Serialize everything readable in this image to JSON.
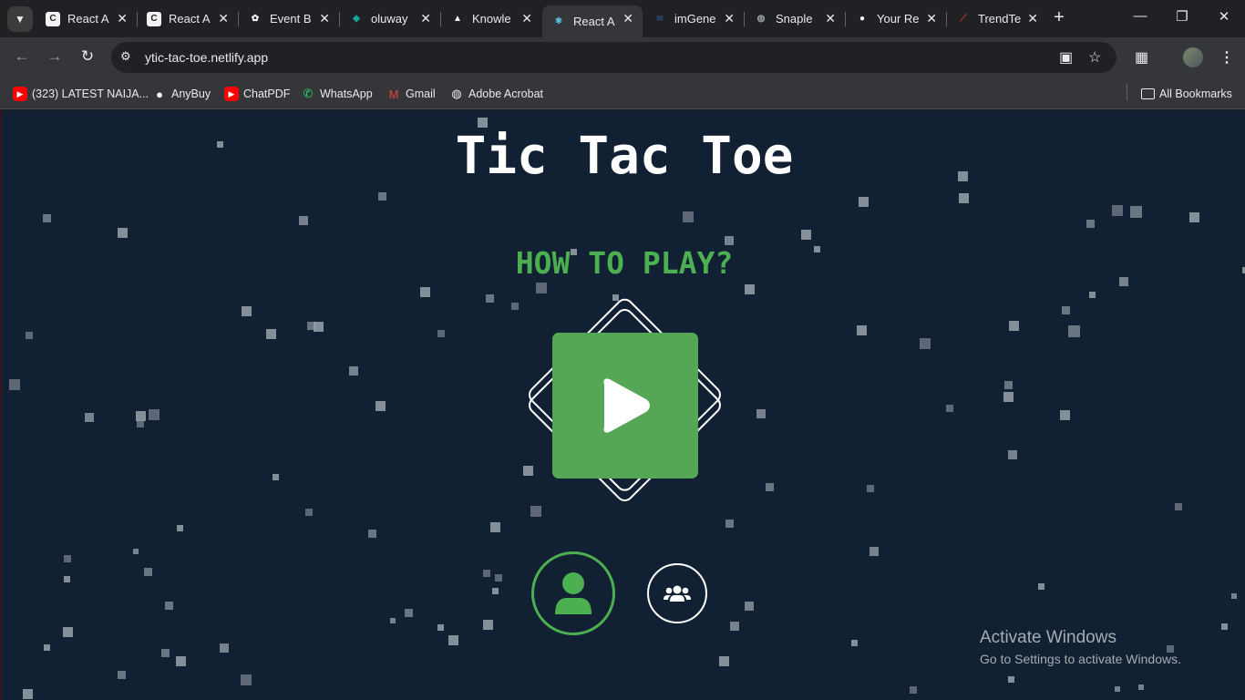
{
  "browser": {
    "tabs": [
      {
        "title": "React A",
        "favicon_icon": "react-a-favicon",
        "color": "#f1f3f4"
      },
      {
        "title": "React A",
        "favicon_icon": "react-a-favicon",
        "color": "#f1f3f4"
      },
      {
        "title": "Event B",
        "favicon_icon": "chatgpt-icon",
        "color": "#ffffff"
      },
      {
        "title": "oluway",
        "favicon_icon": "diamond-icon",
        "color": "#13a89e"
      },
      {
        "title": "Knowle",
        "favicon_icon": "triangle-icon",
        "color": "#ffffff"
      },
      {
        "title": "React A",
        "favicon_icon": "react-icon",
        "color": "#61dafb"
      },
      {
        "title": "imGene",
        "favicon_icon": "imgen-icon",
        "color": "#2c4a6e"
      },
      {
        "title": "Snaple",
        "favicon_icon": "globe-icon",
        "color": "#9aa0a6"
      },
      {
        "title": "Your Re",
        "favicon_icon": "github-icon",
        "color": "#ffffff"
      },
      {
        "title": "TrendTe",
        "favicon_icon": "trend-icon",
        "color": "#d32f2f"
      }
    ],
    "active_tab_index": 5,
    "url": "ytic-tac-toe.netlify.app",
    "bookmarks": [
      {
        "label": "(323) LATEST NAIJA...",
        "icon": "youtube-icon",
        "color": "#ff0000"
      },
      {
        "label": "AnyBuy",
        "icon": "github-icon",
        "color": "#ffffff"
      },
      {
        "label": "ChatPDF",
        "icon": "youtube-icon",
        "color": "#ff0000"
      },
      {
        "label": "WhatsApp",
        "icon": "whatsapp-icon",
        "color": "#25d366"
      },
      {
        "label": "Gmail",
        "icon": "gmail-icon",
        "color": "#ea4335"
      },
      {
        "label": "Adobe Acrobat",
        "icon": "globe-icon",
        "color": "#e8eaed"
      }
    ],
    "all_bookmarks_label": "All Bookmarks"
  },
  "app": {
    "title": "Tic Tac Toe",
    "how_to_play": "HOW TO PLAY?",
    "accent_color": "#4caf50",
    "background_color": "#122033",
    "play_button_icon": "play-icon",
    "modes": [
      {
        "name": "single-player",
        "icon": "user-icon",
        "selected": true
      },
      {
        "name": "multiplayer",
        "icon": "users-icon",
        "selected": false
      }
    ]
  },
  "os": {
    "activate_title": "Activate Windows",
    "activate_subtitle": "Go to Settings to activate Windows."
  }
}
